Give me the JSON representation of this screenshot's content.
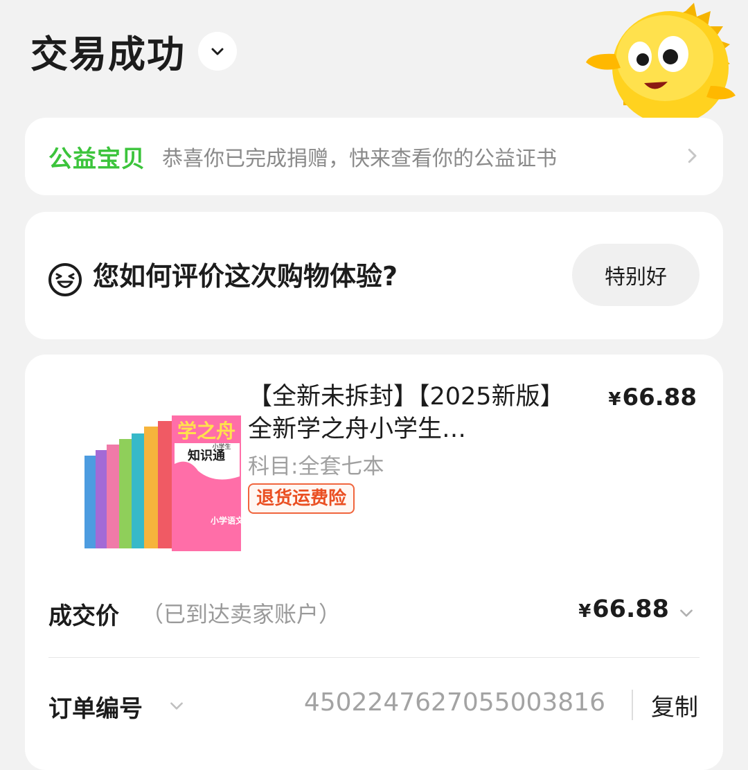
{
  "header": {
    "title": "交易成功",
    "toggle_icon": "chevron-down-icon"
  },
  "charity": {
    "tag": "公益宝贝",
    "text": "恭喜你已完成捐赠，快来查看你的公益证书",
    "tag_color": "#3cc43c"
  },
  "rating": {
    "question": "您如何评价这次购物体验?",
    "button": "特别好",
    "icon": "laughing-face-icon"
  },
  "order": {
    "product_title": "【全新未拆封】【2025新版】全新学之舟小学生…",
    "price_symbol": "¥",
    "price": "66.88",
    "sku": "科目:全套七本",
    "badge": "退货运费险",
    "badge_color": "#ea4f22",
    "deal_label": "成交价",
    "deal_note": "（已到达卖家账户）",
    "deal_symbol": "¥",
    "deal_price": "66.88",
    "order_no_label": "订单编号",
    "order_no": "4502247627055003816",
    "copy": "复制"
  },
  "book_cover": {
    "brand": "学之舟",
    "series": "知识通",
    "subtitle": "小学生",
    "subject": "小学语文"
  },
  "colors": {
    "background": "#f2f2f2",
    "card": "#ffffff"
  }
}
